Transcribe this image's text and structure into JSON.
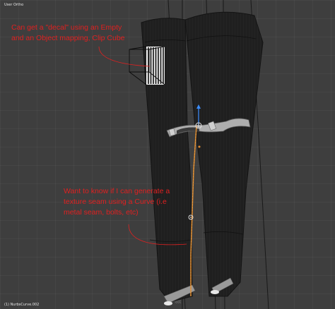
{
  "viewport": {
    "view_label": "User Ortho",
    "object_label": "(1) NurbsCurve.002"
  },
  "annotations": {
    "decal_note": [
      "Can get a \"decal\" using an Empty",
      "and an Object mapping, Clip Cube"
    ],
    "seam_note": [
      "Want to know if I can generate a",
      "texture seam using a Curve (i.e",
      "metal seam, bolts, etc)"
    ]
  },
  "colors": {
    "annotation": "#e02020",
    "curve": "#e08a2c",
    "background": "#3e3e3e",
    "mesh": "#1e1e1e"
  },
  "icons": [
    "empty-origin-icon",
    "transform-gizmo-icon",
    "curve-point-icon"
  ]
}
